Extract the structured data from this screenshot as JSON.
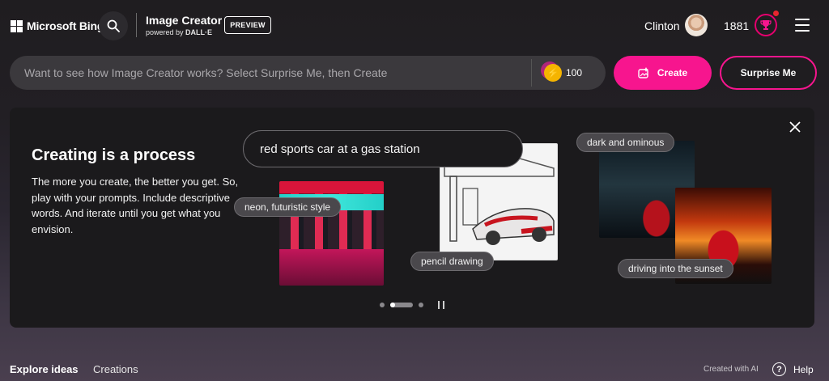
{
  "header": {
    "brand": "Microsoft Bing",
    "app_title": "Image Creator",
    "powered_prefix": "powered by",
    "powered_by": "DALL·E",
    "preview_badge": "PREVIEW",
    "user_name": "Clinton",
    "points": "1881",
    "icons": [
      "microsoft-logo-icon",
      "search-icon",
      "avatar",
      "rewards-trophy-icon",
      "hamburger-menu-icon"
    ]
  },
  "prompt": {
    "placeholder": "Want to see how Image Creator works? Select Surprise Me, then Create",
    "value": "",
    "boosts": "100",
    "create_label": "Create",
    "surprise_label": "Surprise Me"
  },
  "card": {
    "title": "Creating is a process",
    "body": "The more you create, the better you get. So, play with your prompts. Include descriptive words. And iterate until you get what you envision.",
    "base_prompt": "red sports car at a gas station",
    "styles": [
      "neon, futuristic style",
      "pencil drawing",
      "dark and ominous",
      "driving into the sunset"
    ],
    "carousel": {
      "total": 3,
      "active": 2
    }
  },
  "footer": {
    "tabs": [
      "Explore ideas",
      "Creations"
    ],
    "created_with_ai": "Created with AI",
    "help": "Help"
  },
  "colors": {
    "accent": "#f7158e",
    "background": "#1f1d20",
    "card": "#1b1a1c"
  }
}
